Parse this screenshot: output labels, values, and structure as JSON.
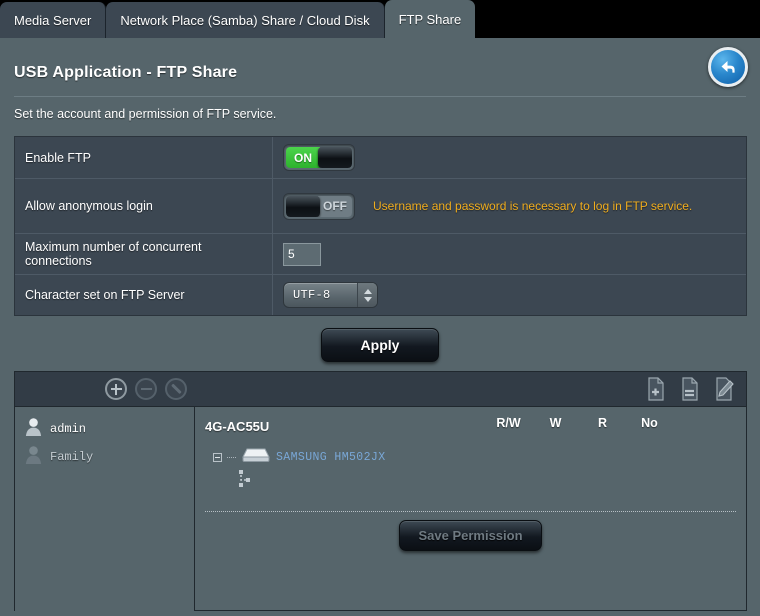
{
  "tabs": [
    {
      "label": "Media Server",
      "active": false
    },
    {
      "label": "Network Place (Samba) Share / Cloud Disk",
      "active": false
    },
    {
      "label": "FTP Share",
      "active": true
    }
  ],
  "header": {
    "title": "USB Application - FTP Share",
    "description": "Set the account and permission of FTP service.",
    "back_icon": "back-arrow-icon"
  },
  "settings": {
    "rows": [
      {
        "label": "Enable FTP",
        "control": "toggle",
        "state": "ON"
      },
      {
        "label": "Allow anonymous login",
        "control": "toggle",
        "state": "OFF",
        "note": "Username and password is necessary to log in FTP service."
      },
      {
        "label": "Maximum number of concurrent connections",
        "control": "number",
        "value": "5"
      },
      {
        "label": "Character set on FTP Server",
        "control": "select",
        "value": "UTF-8"
      }
    ],
    "toggle_on_label": "ON",
    "toggle_off_label": "OFF"
  },
  "apply": {
    "label": "Apply"
  },
  "panel": {
    "toolbar": {
      "add_icon": "plus-circle-icon",
      "remove_icon": "minus-circle-icon",
      "edit_icon": "pencil-circle-icon",
      "add_folder_icon": "file-add-icon",
      "remove_folder_icon": "file-remove-icon",
      "edit_folder_icon": "file-edit-icon"
    },
    "users": [
      {
        "name": "admin",
        "icon": "user-icon",
        "selected": true
      },
      {
        "name": "Family",
        "icon": "user-icon",
        "selected": false
      }
    ],
    "device": {
      "name": "4G-AC55U"
    },
    "permission_columns": [
      "R/W",
      "W",
      "R",
      "No"
    ],
    "tree": {
      "disk_label": "SAMSUNG HM502JX",
      "disk_icon": "hard-disk-icon",
      "toggle_icon": "tree-collapse-icon"
    },
    "save": {
      "label": "Save Permission"
    }
  },
  "colors": {
    "page_background": "#56656b",
    "tab_inactive": "#3c4752",
    "table_background": "#3c4752",
    "warning_text": "#f0ad1e",
    "toggle_on": "#3cc33c",
    "link_text": "#79a7d6",
    "back_button": "#2a87cc"
  }
}
